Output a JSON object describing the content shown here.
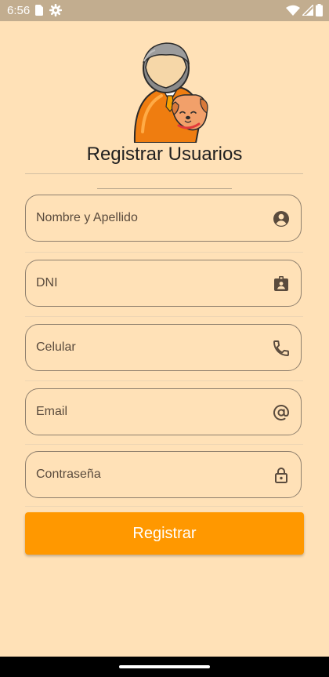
{
  "status_bar": {
    "time": "6:56",
    "left_icons": [
      "sim-card-icon",
      "settings-gear-icon"
    ],
    "right_icons": [
      "wifi-icon",
      "cellular-signal-icon",
      "battery-icon"
    ]
  },
  "page": {
    "title": "Registrar Usuarios",
    "hero_image": "user-with-dog-illustration"
  },
  "form": {
    "fields": [
      {
        "placeholder": "Nombre y Apellido",
        "icon": "account-circle-icon"
      },
      {
        "placeholder": "DNI",
        "icon": "badge-icon"
      },
      {
        "placeholder": "Celular",
        "icon": "phone-icon"
      },
      {
        "placeholder": "Email",
        "icon": "at-sign-icon"
      },
      {
        "placeholder": "Contraseña",
        "icon": "lock-icon"
      }
    ],
    "submit_label": "Registrar"
  },
  "colors": {
    "background": "#ffe1b7",
    "status_bar": "#c2ad8f",
    "accent": "#ff9800",
    "field_border": "#8e7f6d",
    "navigation_bar": "#000000"
  }
}
